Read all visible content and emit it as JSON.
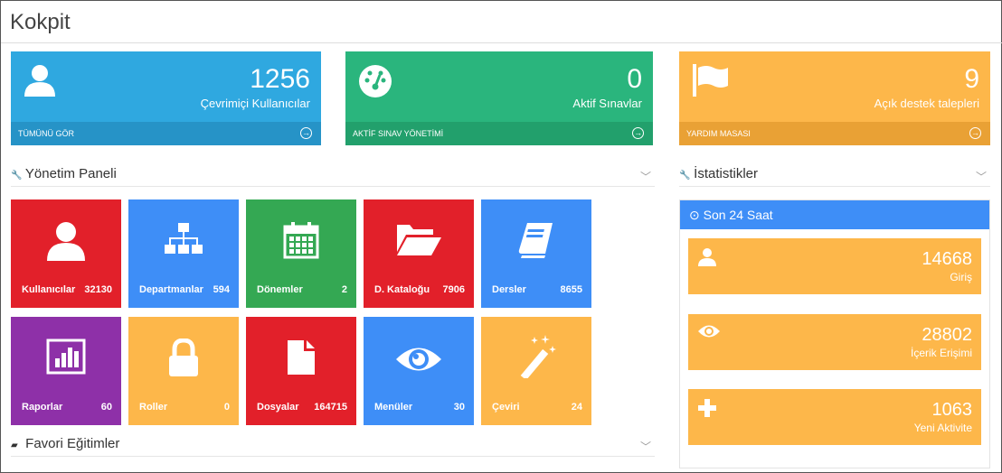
{
  "page": {
    "title": "Kokpit"
  },
  "stats": [
    {
      "value": "1256",
      "label": "Çevrimiçi Kullanıcılar",
      "footer": "TÜMÜNÜ GÖR",
      "icon": "user-icon",
      "color": "#2fa8e0"
    },
    {
      "value": "0",
      "label": "Aktif Sınavlar",
      "footer": "AKTİF SINAV YÖNETİMİ",
      "icon": "dashboard-gauge-icon",
      "color": "#2ab57d"
    },
    {
      "value": "9",
      "label": "Açık destek talepleri",
      "footer": "YARDIM MASASI",
      "icon": "flag-icon",
      "color": "#fdb74a"
    }
  ],
  "management": {
    "title": "Yönetim Paneli",
    "tiles": [
      {
        "label": "Kullanıcılar",
        "count": "32130",
        "icon": "user-icon",
        "color": "#e2202a"
      },
      {
        "label": "Departmanlar",
        "count": "594",
        "icon": "sitemap-icon",
        "color": "#3e8ef7"
      },
      {
        "label": "Dönemler",
        "count": "2",
        "icon": "calendar-icon",
        "color": "#34a853"
      },
      {
        "label": "D. Kataloğu",
        "count": "7906",
        "icon": "folder-open-icon",
        "color": "#e2202a"
      },
      {
        "label": "Dersler",
        "count": "8655",
        "icon": "book-icon",
        "color": "#3e8ef7"
      },
      {
        "label": "Raporlar",
        "count": "60",
        "icon": "bar-chart-icon",
        "color": "#8e30a8"
      },
      {
        "label": "Roller",
        "count": "0",
        "icon": "lock-icon",
        "color": "#fdb74a"
      },
      {
        "label": "Dosyalar",
        "count": "164715",
        "icon": "file-icon",
        "color": "#e2202a"
      },
      {
        "label": "Menüler",
        "count": "30",
        "icon": "eye-icon",
        "color": "#3e8ef7"
      },
      {
        "label": "Çeviri",
        "count": "24",
        "icon": "magic-wand-icon",
        "color": "#fdb74a"
      }
    ]
  },
  "statistics": {
    "title": "İstatistikler",
    "panel_title": "Son 24 Saat",
    "items": [
      {
        "value": "14668",
        "label": "Giriş",
        "icon": "user-icon"
      },
      {
        "value": "28802",
        "label": "İçerik Erişimi",
        "icon": "eye-icon"
      },
      {
        "value": "1063",
        "label": "Yeni Aktivite",
        "icon": "plus-icon"
      }
    ]
  },
  "favorites": {
    "title": "Favori Eğitimler"
  }
}
